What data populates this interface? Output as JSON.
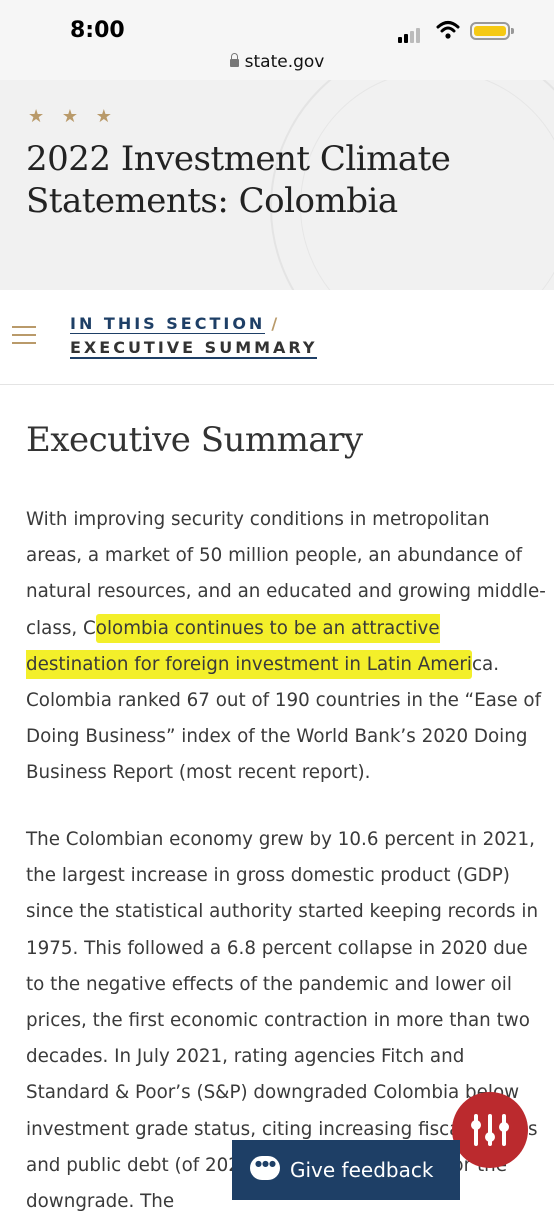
{
  "status_bar": {
    "time": "8:00",
    "url": "state.gov"
  },
  "hero": {
    "stars": "★ ★ ★",
    "title": "2022 Investment Climate Statements: Colombia"
  },
  "section_nav": {
    "label": "IN THIS SECTION",
    "separator": "/",
    "current": "EXECUTIVE SUMMARY"
  },
  "content": {
    "heading": "Executive Summary",
    "p1_before": "With improving security conditions in metropolitan areas, a market of 50 million people, an abundance of natural resources, and an educated and growing middle-class, C",
    "p1_highlight": "olombia continues to be an attractive destination for foreign investment in Latin Ameri",
    "p1_after": "ca. Colombia ranked 67 out of 190 countries in the “Ease of Doing Business” index of the World Bank’s 2020 Doing Business Report (most recent report).",
    "p2": "The Colombian economy grew by 10.6 percent in 2021, the largest increase in gross domestic product (GDP) since the statistical authority started keeping records in 1975. This followed a 6.8 percent collapse in 2020 due to the negative effects of the pandemic and lower oil prices, the first economic contraction in more than two decades. In July 2021, rating agencies Fitch and Standard & Poor’s (S&P) downgraded Colombia below investment grade status, citing increasing fiscal deficits and public debt (of 2021) as the main reason for the downgrade. The"
  },
  "feedback": {
    "label": "Give feedback"
  },
  "colors": {
    "accent_gold": "#b99a6a",
    "navy": "#1e3f66",
    "highlight": "#f3ef2a",
    "fab_red": "#bb2a2e"
  }
}
